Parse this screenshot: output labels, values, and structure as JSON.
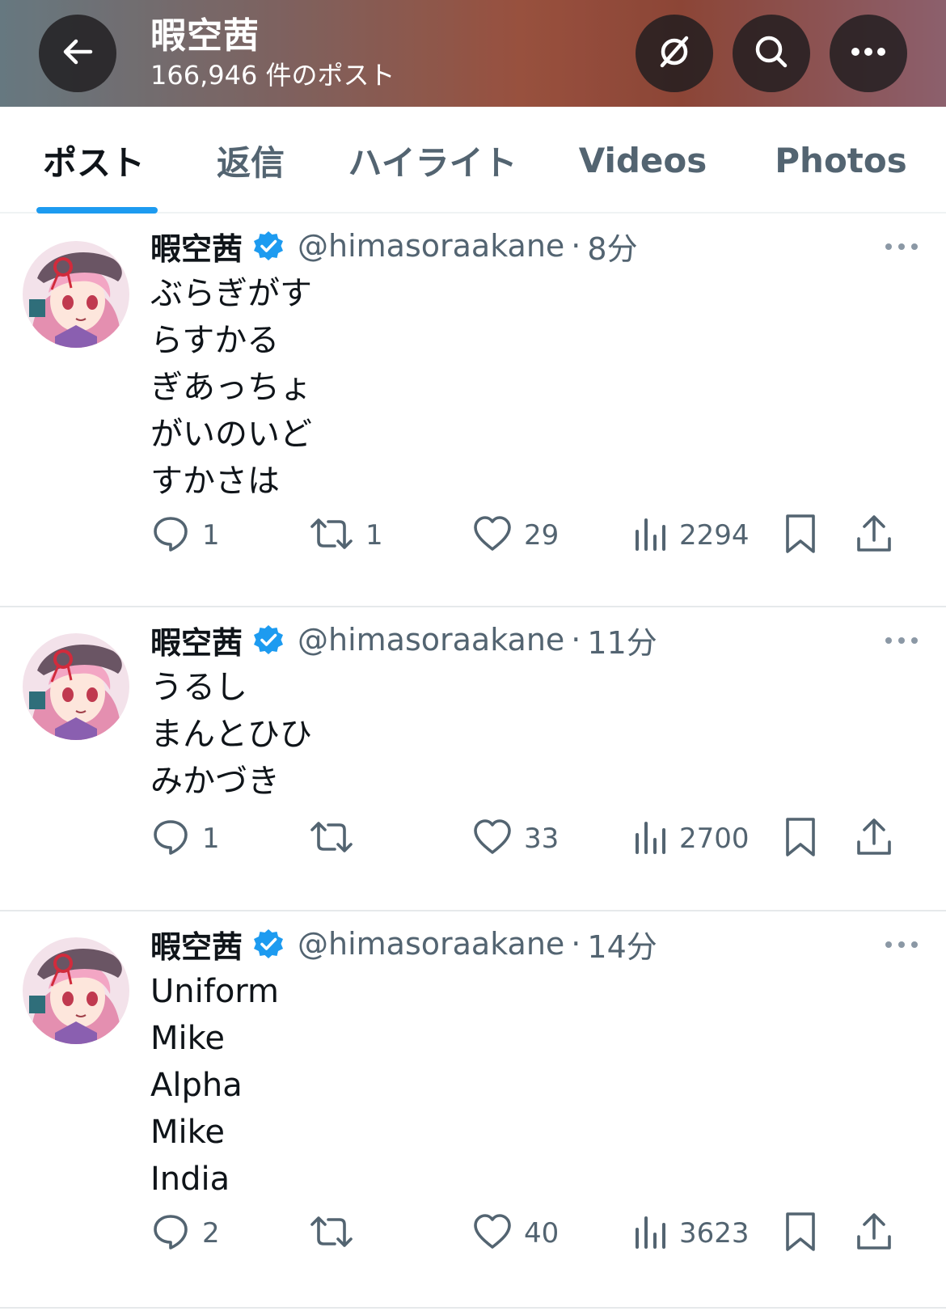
{
  "header": {
    "title": "暇空茜",
    "subtitle": "166,946 件のポスト",
    "icons": [
      "back-arrow-icon",
      "unfollow-icon",
      "search-icon",
      "more-icon"
    ]
  },
  "tabs": [
    {
      "label": "ポスト",
      "active": true
    },
    {
      "label": "返信",
      "active": false
    },
    {
      "label": "ハイライト",
      "active": false
    },
    {
      "label": "Videos",
      "active": false
    },
    {
      "label": "Photos",
      "active": false
    }
  ],
  "colors": {
    "accent": "#1d9bf0",
    "secondary_text": "#536471",
    "primary_text": "#0f1419"
  },
  "posts": [
    {
      "name": "暇空茜",
      "handle": "@himasoraakane",
      "dot": "·",
      "time": "8分",
      "lines": [
        "ぶらぎがす",
        "らすかる",
        "ぎあっちょ",
        "がいのいど",
        "すかさは"
      ],
      "replies": "1",
      "reposts": "1",
      "likes": "29",
      "views": "2294"
    },
    {
      "name": "暇空茜",
      "handle": "@himasoraakane",
      "dot": "·",
      "time": "11分",
      "lines": [
        "うるし",
        "まんとひひ",
        "みかづき"
      ],
      "replies": "1",
      "reposts": "",
      "likes": "33",
      "views": "2700"
    },
    {
      "name": "暇空茜",
      "handle": "@himasoraakane",
      "dot": "·",
      "time": "14分",
      "lines": [
        "Uniform",
        "Mike",
        "Alpha",
        "Mike",
        "India"
      ],
      "replies": "2",
      "reposts": "",
      "likes": "40",
      "views": "3623"
    }
  ]
}
